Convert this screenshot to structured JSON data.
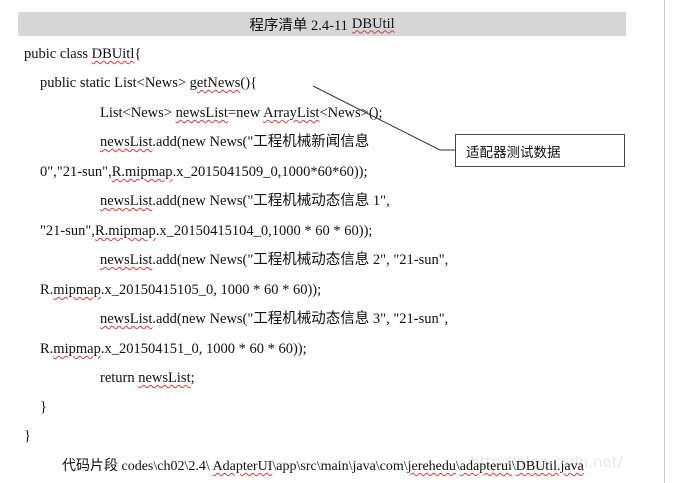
{
  "listing": {
    "title_prefix": "程序清单 2.4-11",
    "title_name": "DBUtil"
  },
  "code": {
    "l1_a": "pubic class ",
    "l1_b": "DBUitl",
    "l1_c": "{",
    "l2_a": "public static List<News> ",
    "l2_b": "getNews",
    "l2_c": "(){",
    "l3_a": "List<News> ",
    "l3_b": "newsList",
    "l3_c": "=new ",
    "l3_d": "ArrayList",
    "l3_e": "<News>();",
    "l4_a": "newsList",
    "l4_b": ".add(new News(\"工程机械新闻信息",
    "l5_a": "0\",\"21-sun\",",
    "l5_b": "R.mipmap",
    "l5_c": ".x_2015041509_0,1000*60*60));",
    "l6_a": "newsList",
    "l6_b": ".add(new News(\"工程机械动态信息 1\",",
    "l7_a": "\"21-sun\",",
    "l7_b": "R.mipmap",
    "l7_c": ".x_20150415104_0,1000 * 60 * 60));",
    "l8_a": "newsList",
    "l8_b": ".add(new News(\"工程机械动态信息 2\", \"21-sun\",",
    "l9_a": "R.",
    "l9_b": "mipmap",
    "l9_c": ".x_20150415105_0, 1000 * 60 * 60));",
    "l10_a": "newsList",
    "l10_b": ".add(new News(\"工程机械动态信息 3\", \"21-sun\",",
    "l11_a": "R.",
    "l11_b": "mipmap",
    "l11_c": ".x_201504151_0, 1000 * 60 * 60));",
    "l12_a": "return   ",
    "l12_b": "newsList",
    "l12_c": ";",
    "l13": "}",
    "l14": "}"
  },
  "callout": {
    "label": "适配器测试数据"
  },
  "footer": {
    "prefix": "代码片段 codes\\ch02\\2.4\\ ",
    "p1": "AdapterUI",
    "p2": "\\app\\src\\main\\java\\com\\",
    "p3": "jerehedu",
    "p4": "\\",
    "p5": "adapterui",
    "p6": "\\",
    "p7": "DBUtil.java"
  },
  "watermark": "http://blog.csdn.net/"
}
